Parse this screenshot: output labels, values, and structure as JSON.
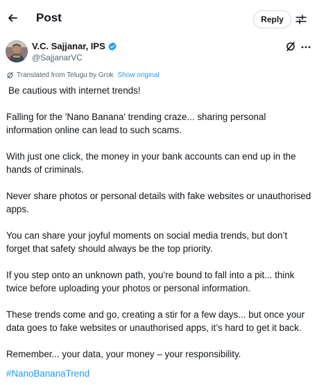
{
  "header": {
    "title": "Post",
    "reply_label": "Reply",
    "back_icon": "arrow-left-icon",
    "filter_icon": "sliders-icon"
  },
  "author": {
    "name": "V.C. Sajjanar, IPS",
    "handle": "@SajjanarVC",
    "verified": true,
    "verified_color": "#1d9bf0"
  },
  "translation": {
    "label": "Translated from Telugu by Grok",
    "show_original": "Show original"
  },
  "post": {
    "paragraphs": [
      "Be cautious with internet trends!",
      "Falling for the 'Nano Banana' trending craze... sharing personal information online can lead to such scams.",
      "With just one click, the money in your bank accounts can end up in the hands of criminals.",
      "Never share photos or personal details with fake websites or unauthorised apps.",
      "You can share your joyful moments on social media trends, but don’t forget that safety should always be the top priority.",
      "If you step onto an unknown path, you’re bound to fall into a pit... think twice before uploading your photos or personal information.",
      "These trends come and go, creating a stir for a few days... but once your data goes to fake websites or unauthorised apps, it’s hard to get it back.",
      "Remember... your data, your money – your responsibility."
    ],
    "hashtag": "#NanoBananaTrend"
  },
  "colors": {
    "link": "#1d9bf0",
    "text": "#0f1419",
    "secondary": "#536471"
  }
}
